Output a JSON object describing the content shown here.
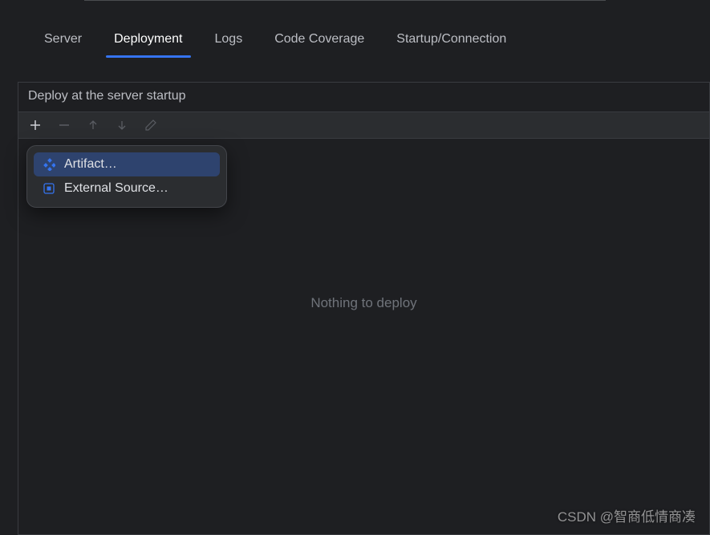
{
  "tabs": {
    "server": "Server",
    "deployment": "Deployment",
    "logs": "Logs",
    "coverage": "Code Coverage",
    "startup": "Startup/Connection"
  },
  "panel": {
    "title": "Deploy at the server startup",
    "empty": "Nothing to deploy"
  },
  "popup": {
    "artifact": "Artifact…",
    "external": "External Source…"
  },
  "watermark": "CSDN @智商低情商凑"
}
